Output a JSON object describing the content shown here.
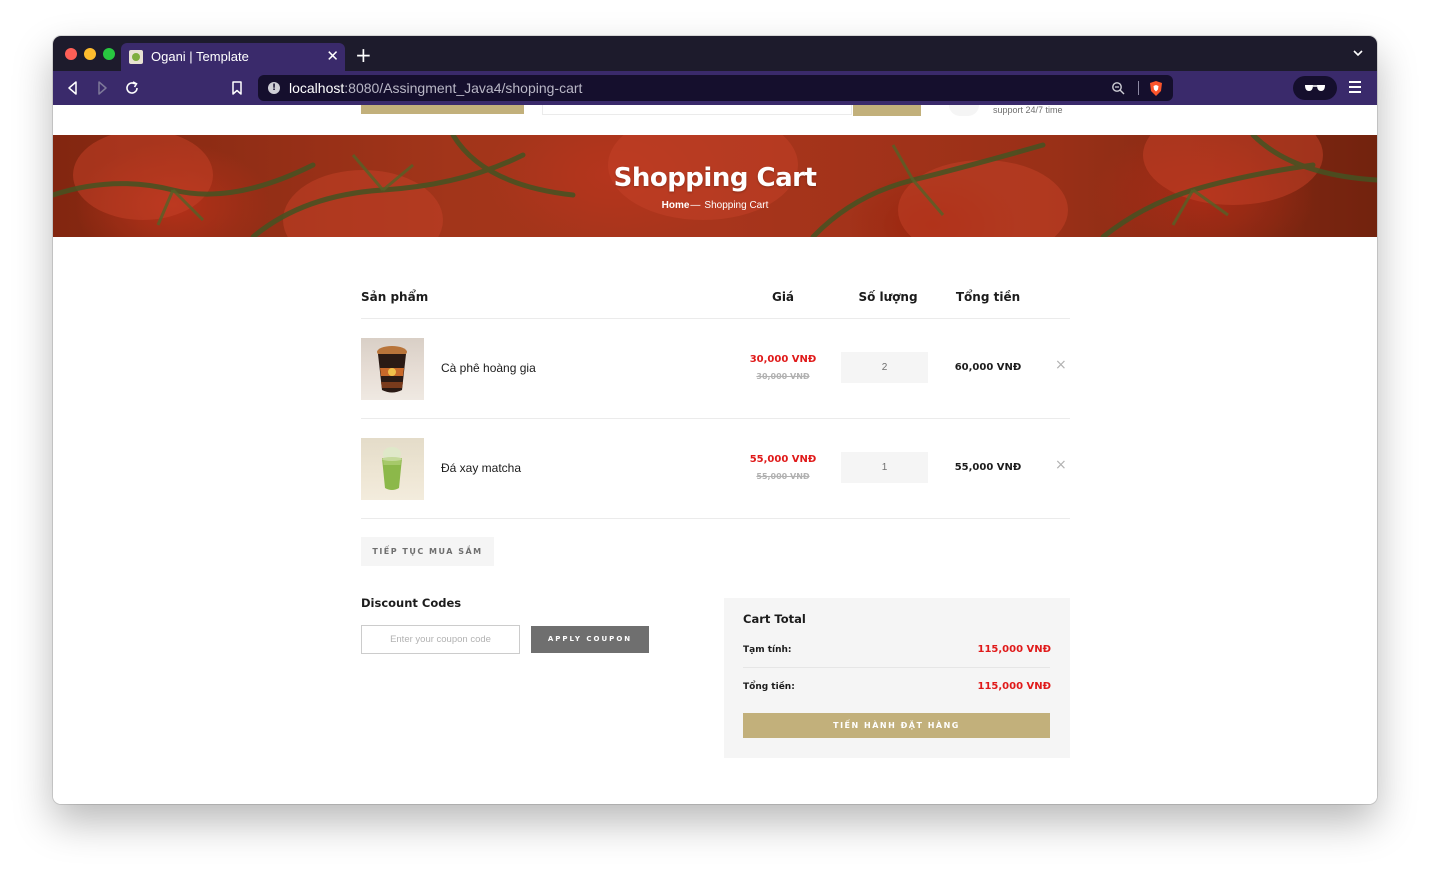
{
  "browser": {
    "tab_title": "Ogani | Template",
    "url_host": "localhost",
    "url_rest": ":8080/Assingment_Java4/shoping-cart"
  },
  "header": {
    "support_text": "support 24/7 time"
  },
  "hero": {
    "title": "Shopping Cart",
    "breadcrumb_home": "Home",
    "breadcrumb_separator": "—",
    "breadcrumb_current": "Shopping Cart"
  },
  "cart": {
    "columns": {
      "product": "Sản phẩm",
      "price": "Giá",
      "quantity": "Số lượng",
      "total": "Tổng tiền"
    },
    "items": [
      {
        "name": "Cà phê hoàng gia",
        "sale_price": "30,000 VNĐ",
        "old_price": "30,000 VNĐ",
        "quantity": "2",
        "total": "60,000 VNĐ",
        "remove_icon": "×"
      },
      {
        "name": "Đá xay matcha",
        "sale_price": "55,000 VNĐ",
        "old_price": "55,000 VNĐ",
        "quantity": "1",
        "total": "55,000 VNĐ",
        "remove_icon": "×"
      }
    ],
    "continue_label": "TIẾP TỤC MUA SẮM"
  },
  "discount": {
    "title": "Discount Codes",
    "placeholder": "Enter your coupon code",
    "apply_label": "APPLY COUPON"
  },
  "cart_total": {
    "title": "Cart Total",
    "subtotal_label": "Tạm tính:",
    "subtotal_value": "115,000 VNĐ",
    "total_label": "Tổng tiền:",
    "total_value": "115,000 VNĐ",
    "checkout_label": "TIẾN HÀNH ĐẶT HÀNG"
  },
  "colors": {
    "accent": "#c2b07b",
    "price_red": "#e01a1a",
    "browser_chrome": "#3a2a6b"
  }
}
